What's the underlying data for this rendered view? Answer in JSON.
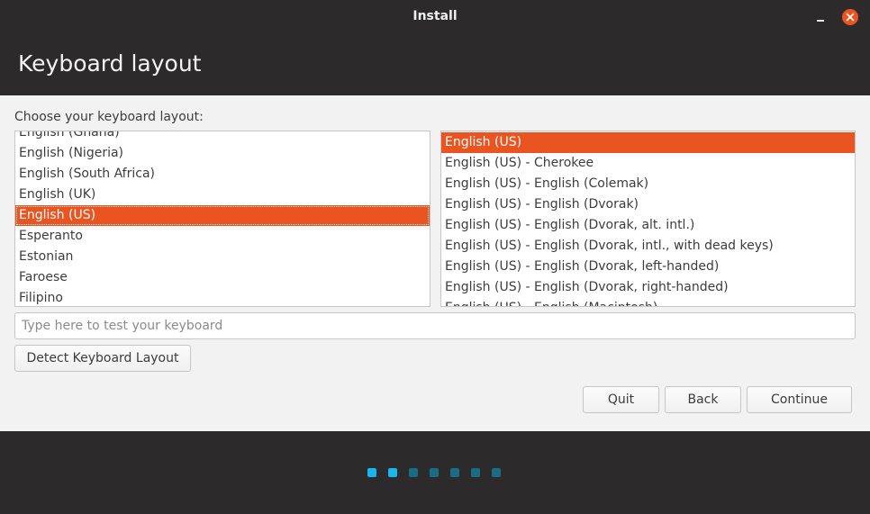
{
  "window": {
    "title": "Install"
  },
  "page": {
    "heading": "Keyboard layout",
    "prompt": "Choose your keyboard layout:"
  },
  "layouts": [
    "English (Ghana)",
    "English (Nigeria)",
    "English (South Africa)",
    "English (UK)",
    "English (US)",
    "Esperanto",
    "Estonian",
    "Faroese",
    "Filipino"
  ],
  "layouts_selected": "English (US)",
  "variants": [
    "English (US)",
    "English (US) - Cherokee",
    "English (US) - English (Colemak)",
    "English (US) - English (Dvorak)",
    "English (US) - English (Dvorak, alt. intl.)",
    "English (US) - English (Dvorak, intl., with dead keys)",
    "English (US) - English (Dvorak, left-handed)",
    "English (US) - English (Dvorak, right-handed)",
    "English (US) - English (Macintosh)"
  ],
  "variants_selected": "English (US)",
  "test_input": {
    "placeholder": "Type here to test your keyboard",
    "value": ""
  },
  "buttons": {
    "detect": "Detect Keyboard Layout",
    "quit": "Quit",
    "back": "Back",
    "continue": "Continue"
  },
  "progress": {
    "total_steps": 7,
    "completed_steps": 2
  },
  "colors": {
    "accent": "#e95420",
    "dot_active": "#19b6ee",
    "dot_inactive": "#1c6b85",
    "dark_bg": "#2c2a2b"
  }
}
